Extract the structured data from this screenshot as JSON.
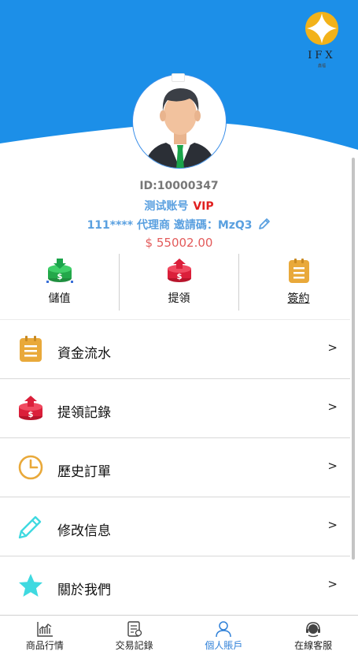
{
  "colors": {
    "header_blue": "#1c8fe8",
    "accent_blue": "#5aa0e0",
    "vip_red": "#e02020",
    "balance_red": "#e35b5b",
    "active_tab": "#2f80d8"
  },
  "brand": {
    "name": "IFX",
    "sub": "鑫福"
  },
  "profile": {
    "id_text": "ID:10000347",
    "account_name": "测试账号",
    "vip": "VIP",
    "agent_text": "111**** 代理商 邀請碼：MzQ3",
    "balance": "$ 55002.00"
  },
  "actions": [
    {
      "label": "儲值",
      "icon": "deposit-icon"
    },
    {
      "label": "提領",
      "icon": "withdraw-icon"
    },
    {
      "label": "簽約",
      "icon": "contract-icon"
    }
  ],
  "menu": [
    {
      "label": "資金流水",
      "icon": "ledger-icon",
      "chevron": ">"
    },
    {
      "label": "提領記錄",
      "icon": "withdraw-record-icon",
      "chevron": ">"
    },
    {
      "label": "歷史訂單",
      "icon": "clock-icon",
      "chevron": ">"
    },
    {
      "label": "修改信息",
      "icon": "pencil-icon",
      "chevron": ">"
    },
    {
      "label": "關於我們",
      "icon": "star-icon",
      "chevron": ">"
    }
  ],
  "tabs": [
    {
      "label": "商品行情",
      "icon": "chart-icon",
      "active": false
    },
    {
      "label": "交易記錄",
      "icon": "record-icon",
      "active": false
    },
    {
      "label": "個人賬戶",
      "icon": "user-icon",
      "active": true
    },
    {
      "label": "在線客服",
      "icon": "support-icon",
      "active": false
    }
  ]
}
